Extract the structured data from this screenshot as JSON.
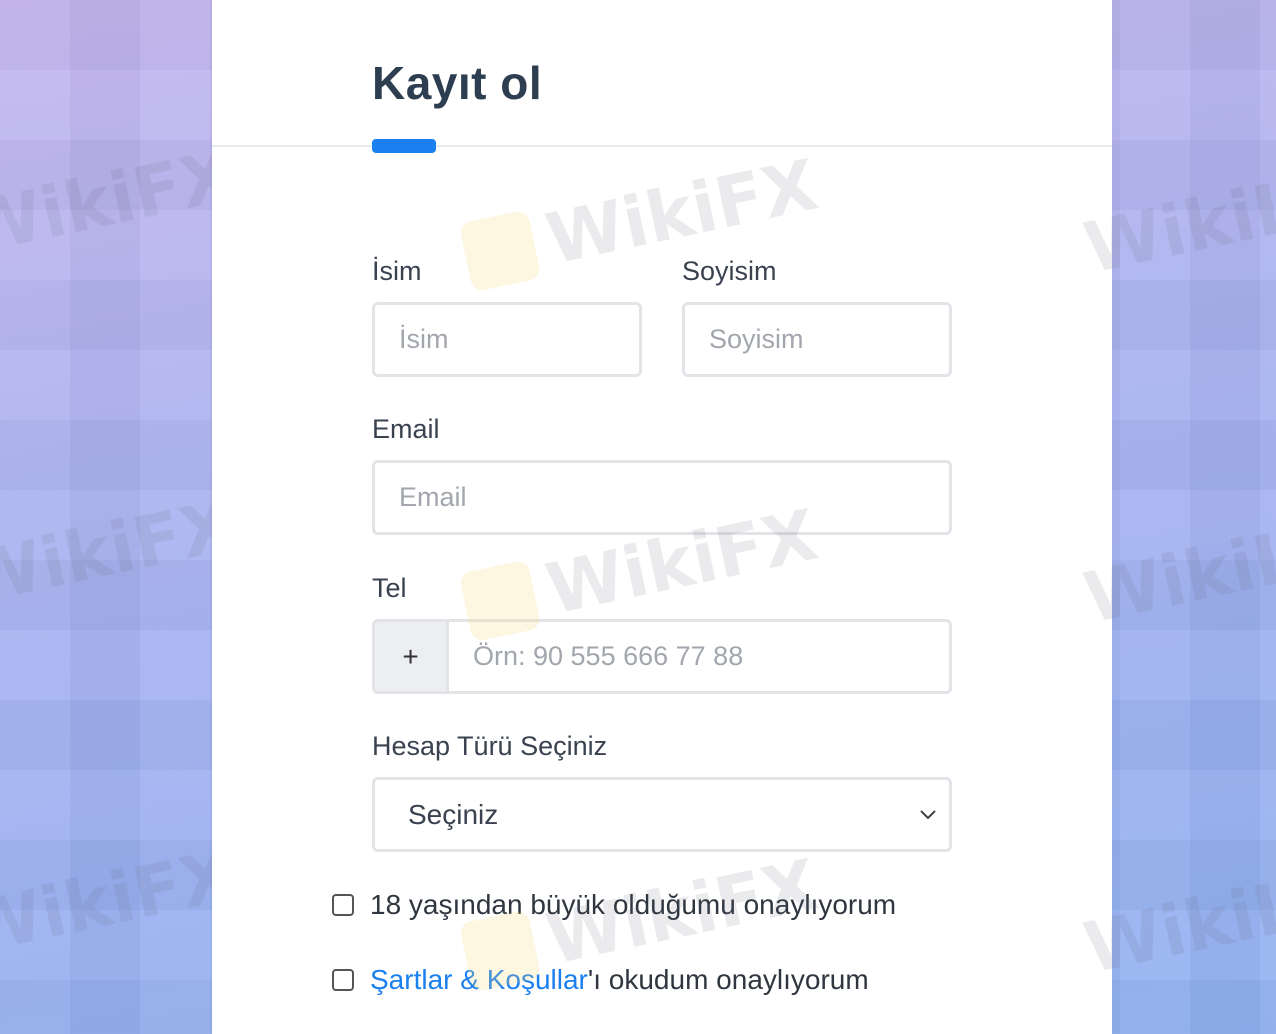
{
  "form": {
    "title": "Kayıt ol",
    "first_name": {
      "label": "İsim",
      "placeholder": "İsim"
    },
    "last_name": {
      "label": "Soyisim",
      "placeholder": "Soyisim"
    },
    "email": {
      "label": "Email",
      "placeholder": "Email"
    },
    "phone": {
      "label": "Tel",
      "prefix": "+",
      "placeholder": "Örn: 90 555 666 77 88"
    },
    "account_type": {
      "label": "Hesap Türü Seçiniz",
      "selected": "Seçiniz"
    },
    "age_consent": {
      "label": "18 yaşından büyük olduğumu onaylıyorum",
      "checked": false
    },
    "terms_consent": {
      "link_text": "Şartlar & Koşullar",
      "suffix": "'ı okudum onaylıyorum",
      "checked": false
    }
  },
  "watermark": {
    "text": "WikiFX"
  },
  "colors": {
    "accent": "#1a7fef",
    "title": "#2c3e50",
    "border": "#e2e4e8"
  }
}
